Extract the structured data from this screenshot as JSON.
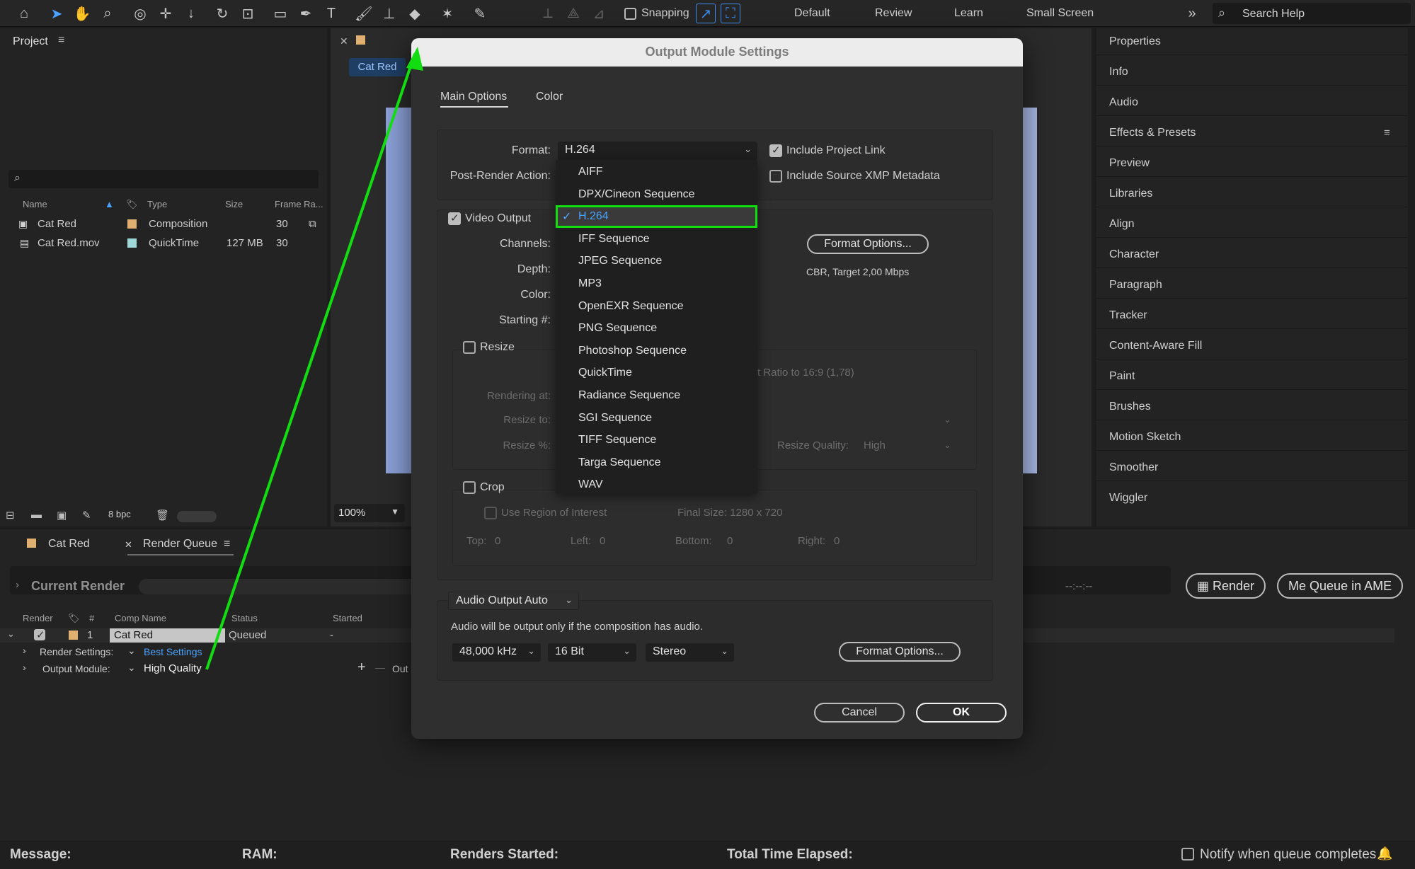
{
  "toolbar": {
    "snapping_label": "Snapping",
    "workspaces": [
      "Default",
      "Review",
      "Learn",
      "Small Screen"
    ],
    "search_placeholder": "Search Help"
  },
  "project": {
    "title": "Project",
    "columns": [
      "Name",
      "Type",
      "Size",
      "Frame Ra..."
    ],
    "items": [
      {
        "name": "Cat Red",
        "type": "Composition",
        "size": "",
        "frame_rate": "30",
        "color": "#e0b070"
      },
      {
        "name": "Cat Red.mov",
        "type": "QuickTime",
        "size": "127 MB",
        "frame_rate": "30",
        "color": "#9fd8d8"
      }
    ],
    "bpc": "8 bpc"
  },
  "viewer": {
    "tab": "Cat Red",
    "zoom": "100%"
  },
  "right_panel": {
    "items": [
      "Properties",
      "Info",
      "Audio",
      "Effects & Presets",
      "Preview",
      "Libraries",
      "Align",
      "Character",
      "Paragraph",
      "Tracker",
      "Content-Aware Fill",
      "Paint",
      "Brushes",
      "Motion Sketch",
      "Smoother",
      "Wiggler"
    ]
  },
  "render_queue": {
    "tabs": [
      "Cat Red",
      "Render Queue"
    ],
    "current_render": "Current Render",
    "time_placeholder": "--:--:--",
    "render_button": "Render",
    "queue_ame_button": "Queue in AME",
    "columns": [
      "Render",
      "#",
      "Comp Name",
      "Status",
      "Started"
    ],
    "row": {
      "index": "1",
      "comp_name": "Cat Red",
      "status": "Queued",
      "started": "-"
    },
    "render_settings_label": "Render Settings:",
    "render_settings_value": "Best Settings",
    "output_module_label": "Output Module:",
    "output_module_value": "High Quality",
    "output_to_fragment": "Out"
  },
  "status_bar": {
    "message": "Message:",
    "ram": "RAM:",
    "renders_started": "Renders Started:",
    "total_time": "Total Time Elapsed:",
    "notify": "Notify when queue completes"
  },
  "modal": {
    "title": "Output Module Settings",
    "tabs": [
      "Main Options",
      "Color"
    ],
    "format_label": "Format:",
    "format_value": "H.264",
    "post_render_label": "Post-Render Action:",
    "include_project_link": "Include Project Link",
    "include_xmp": "Include Source XMP Metadata",
    "video_output": "Video Output",
    "channels_label": "Channels:",
    "depth_label": "Depth:",
    "color_label": "Color:",
    "starting_label": "Starting #:",
    "format_options": "Format Options...",
    "codec_info": "CBR, Target 2,00 Mbps",
    "resize": "Resize",
    "aspect_fragment": "t Ratio to 16:9 (1,78)",
    "rendering_at": "Rendering at:",
    "resize_to": "Resize to:",
    "resize_pct": "Resize %:",
    "resize_quality_label": "Resize Quality:",
    "resize_quality_value": "High",
    "crop": "Crop",
    "use_roi": "Use Region of Interest",
    "final_size": "Final Size: 1280 x 720",
    "crop_fields": [
      {
        "label": "Top:",
        "value": "0"
      },
      {
        "label": "Left:",
        "value": "0"
      },
      {
        "label": "Bottom:",
        "value": "0"
      },
      {
        "label": "Right:",
        "value": "0"
      }
    ],
    "audio_output": "Audio Output Auto",
    "audio_note": "Audio will be output only if the composition has audio.",
    "sample_rate": "48,000 kHz",
    "bit_depth": "16 Bit",
    "channels_audio": "Stereo",
    "audio_format_options": "Format Options...",
    "cancel": "Cancel",
    "ok": "OK",
    "format_list": [
      "AIFF",
      "DPX/Cineon Sequence",
      "H.264",
      "IFF Sequence",
      "JPEG Sequence",
      "MP3",
      "OpenEXR Sequence",
      "PNG Sequence",
      "Photoshop Sequence",
      "QuickTime",
      "Radiance Sequence",
      "SGI Sequence",
      "TIFF Sequence",
      "Targa Sequence",
      "WAV"
    ],
    "format_selected": "H.264"
  },
  "colors": {
    "annotation": "#11dd11",
    "accent": "#4aa3ff"
  }
}
